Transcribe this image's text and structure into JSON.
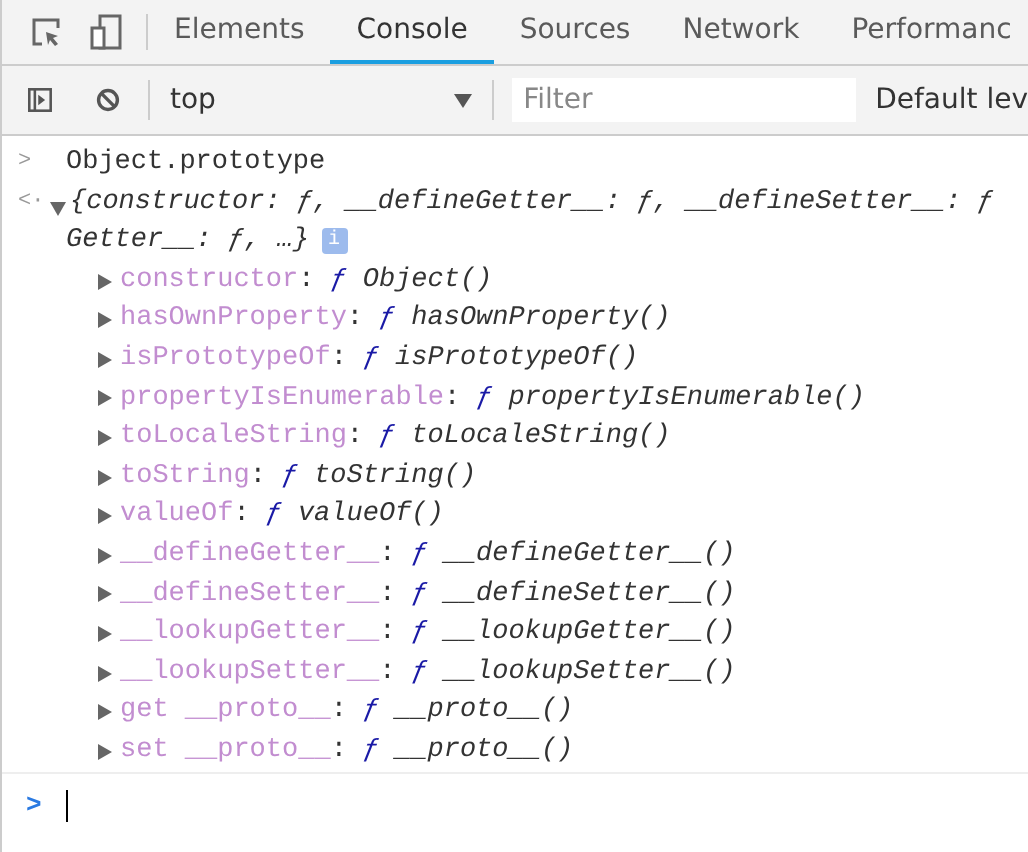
{
  "tabs": [
    {
      "label": "Elements",
      "selected": false
    },
    {
      "label": "Console",
      "selected": true
    },
    {
      "label": "Sources",
      "selected": false
    },
    {
      "label": "Network",
      "selected": false
    },
    {
      "label": "Performanc",
      "selected": false
    }
  ],
  "toolbar": {
    "context": "top",
    "filter": {
      "placeholder": "Filter"
    },
    "levels": "Default lev"
  },
  "input": {
    "prompt": ">",
    "command": "Object.prototype"
  },
  "result": {
    "prompt": "<·",
    "expanded": true,
    "preview_line_1": "{constructor: ƒ, __defineGetter__: ƒ, __defineSetter__: ƒ",
    "preview_line_2": "Getter__: ƒ, …}",
    "info": "i",
    "properties": [
      {
        "name": "constructor",
        "separator": ":",
        "sign": "ƒ",
        "value": "Object()",
        "expanded": false
      },
      {
        "name": "hasOwnProperty",
        "separator": ":",
        "sign": "ƒ",
        "value": "hasOwnProperty()",
        "expanded": false
      },
      {
        "name": "isPrototypeOf",
        "separator": ":",
        "sign": "ƒ",
        "value": "isPrototypeOf()",
        "expanded": false
      },
      {
        "name": "propertyIsEnumerable",
        "separator": ":",
        "sign": "ƒ",
        "value": "propertyIsEnumerable()",
        "expanded": false
      },
      {
        "name": "toLocaleString",
        "separator": ":",
        "sign": "ƒ",
        "value": "toLocaleString()",
        "expanded": false
      },
      {
        "name": "toString",
        "separator": ":",
        "sign": "ƒ",
        "value": "toString()",
        "expanded": false
      },
      {
        "name": "valueOf",
        "separator": ":",
        "sign": "ƒ",
        "value": "valueOf()",
        "expanded": false
      },
      {
        "name": "__defineGetter__",
        "separator": ":",
        "sign": "ƒ",
        "value": "__defineGetter__()",
        "expanded": false
      },
      {
        "name": "__defineSetter__",
        "separator": ":",
        "sign": "ƒ",
        "value": "__defineSetter__()",
        "expanded": false
      },
      {
        "name": "__lookupGetter__",
        "separator": ":",
        "sign": "ƒ",
        "value": "__lookupGetter__()",
        "expanded": false
      },
      {
        "name": "__lookupSetter__",
        "separator": ":",
        "sign": "ƒ",
        "value": "__lookupSetter__()",
        "expanded": false
      },
      {
        "name": "get __proto__",
        "separator": ":",
        "sign": "ƒ",
        "value": "__proto__()",
        "expanded": false
      },
      {
        "name": "set __proto__",
        "separator": ":",
        "sign": "ƒ",
        "value": "__proto__()",
        "expanded": false
      }
    ]
  },
  "prompt": ">"
}
